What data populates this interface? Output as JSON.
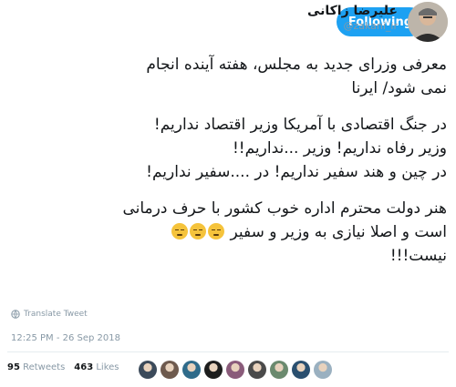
{
  "header": {
    "display_name": "علیرضا زاکانی",
    "handle": "@zakani_ir",
    "follow_label": "Following"
  },
  "tweet": {
    "paragraphs": [
      [
        "معرفی وزرای جدید به مجلس، هفته آینده انجام",
        "نمی شود/ ایرنا"
      ],
      [
        "در جنگ اقتصادی با آمریکا وزیر اقتصاد نداریم!",
        "وزیر رفاه نداریم! وزیر ...نداریم!!",
        "در چین و هند سفیر نداریم! در ....سفیر نداریم!"
      ],
      [
        "هنر دولت محترم اداره خوب کشور با حرف درمانی",
        "است و اصلا نیازی به وزیر و سفیر",
        "نیست!!!"
      ]
    ],
    "emoji_count": 3,
    "translate_label": "Translate Tweet",
    "timestamp": "12:25 PM - 26 Sep 2018"
  },
  "stats": {
    "retweets_count": "95",
    "retweets_label": "Retweets",
    "likes_count": "463",
    "likes_label": "Likes"
  },
  "colors": {
    "accent": "#1da1f2",
    "text": "#14171a",
    "muted": "#8899a6"
  },
  "likers": [
    {
      "icon": "liker-avatar",
      "color": "#3b4a5a"
    },
    {
      "icon": "liker-avatar",
      "color": "#6e5a4e"
    },
    {
      "icon": "liker-avatar",
      "color": "#2f6b8a"
    },
    {
      "icon": "liker-avatar",
      "color": "#1d1d1d"
    },
    {
      "icon": "liker-avatar",
      "color": "#8a5b7a"
    },
    {
      "icon": "liker-avatar",
      "color": "#4a4a4a"
    },
    {
      "icon": "liker-avatar",
      "color": "#6b8a6e"
    },
    {
      "icon": "liker-avatar",
      "color": "#2a4f6f"
    },
    {
      "icon": "liker-avatar",
      "color": "#9ab0c0"
    }
  ]
}
